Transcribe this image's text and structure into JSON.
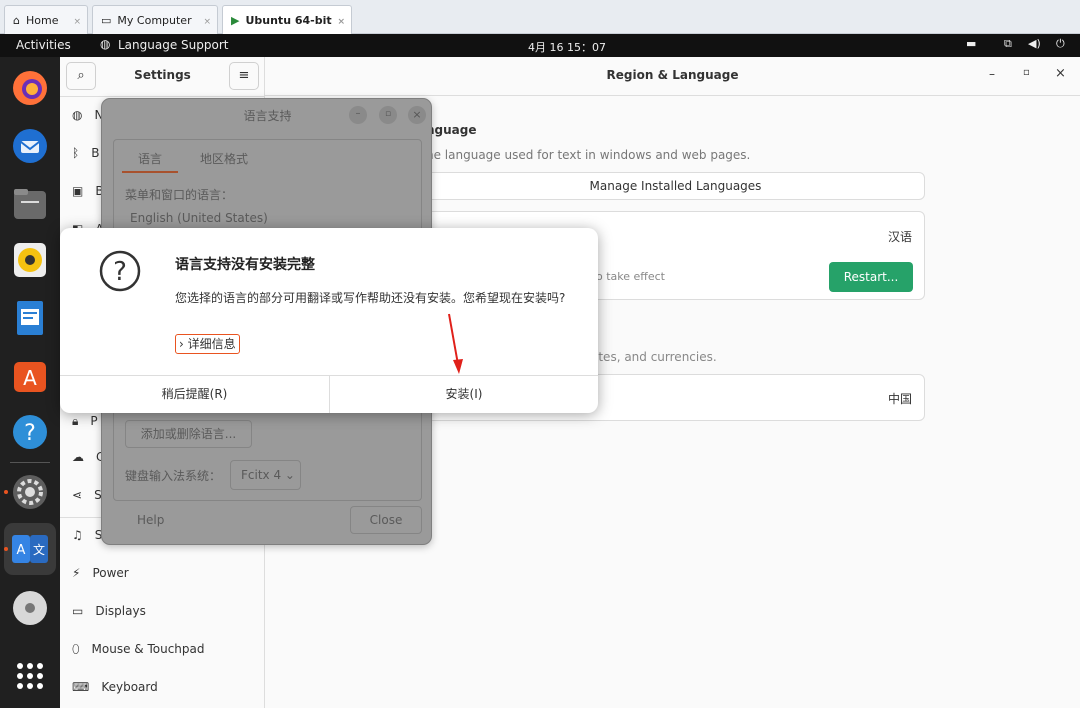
{
  "vm_tabs": [
    {
      "label": "Home"
    },
    {
      "label": "My Computer"
    },
    {
      "label": "Ubuntu 64-bit"
    }
  ],
  "topbar": {
    "activities": "Activities",
    "app": "Language Support",
    "clock": "4月 16  15：07"
  },
  "settings": {
    "title": "Settings",
    "page_title": "Region & Language",
    "sidebar": [
      "N",
      "B",
      "B",
      "A",
      "P",
      "C",
      "S",
      "S",
      "Power",
      "Displays",
      "Mouse & Touchpad",
      "Keyboard"
    ],
    "language_heading": "nguage",
    "language_desc": "he language used for text in windows and web pages.",
    "manage_button": "Manage Installed Languages",
    "language_value": "汉语",
    "restart_note": "o take effect",
    "restart_button": "Restart...",
    "formats_desc": "ates, and currencies.",
    "formats_value": "中国"
  },
  "langwin": {
    "title": "语言支持",
    "tab_language": "语言",
    "tab_region": "地区格式",
    "menu_label": "菜单和窗口的语言：",
    "lang_item": "English (United States)",
    "add_remove": "添加或删除语言...",
    "im_label": "键盘输入法系统：",
    "im_value": "Fcitx 4",
    "help": "Help",
    "close": "Close"
  },
  "dialog": {
    "title": "语言支持没有安装完整",
    "body": "您选择的语言的部分可用翻译或写作帮助还没有安装。您希望现在安装吗?",
    "details": "详细信息",
    "later": "稍后提醒(R)",
    "install": "安装(I)"
  },
  "colors": {
    "accent": "#e95420",
    "green": "#26a269",
    "dock": "#202020",
    "topbar": "#111111"
  }
}
